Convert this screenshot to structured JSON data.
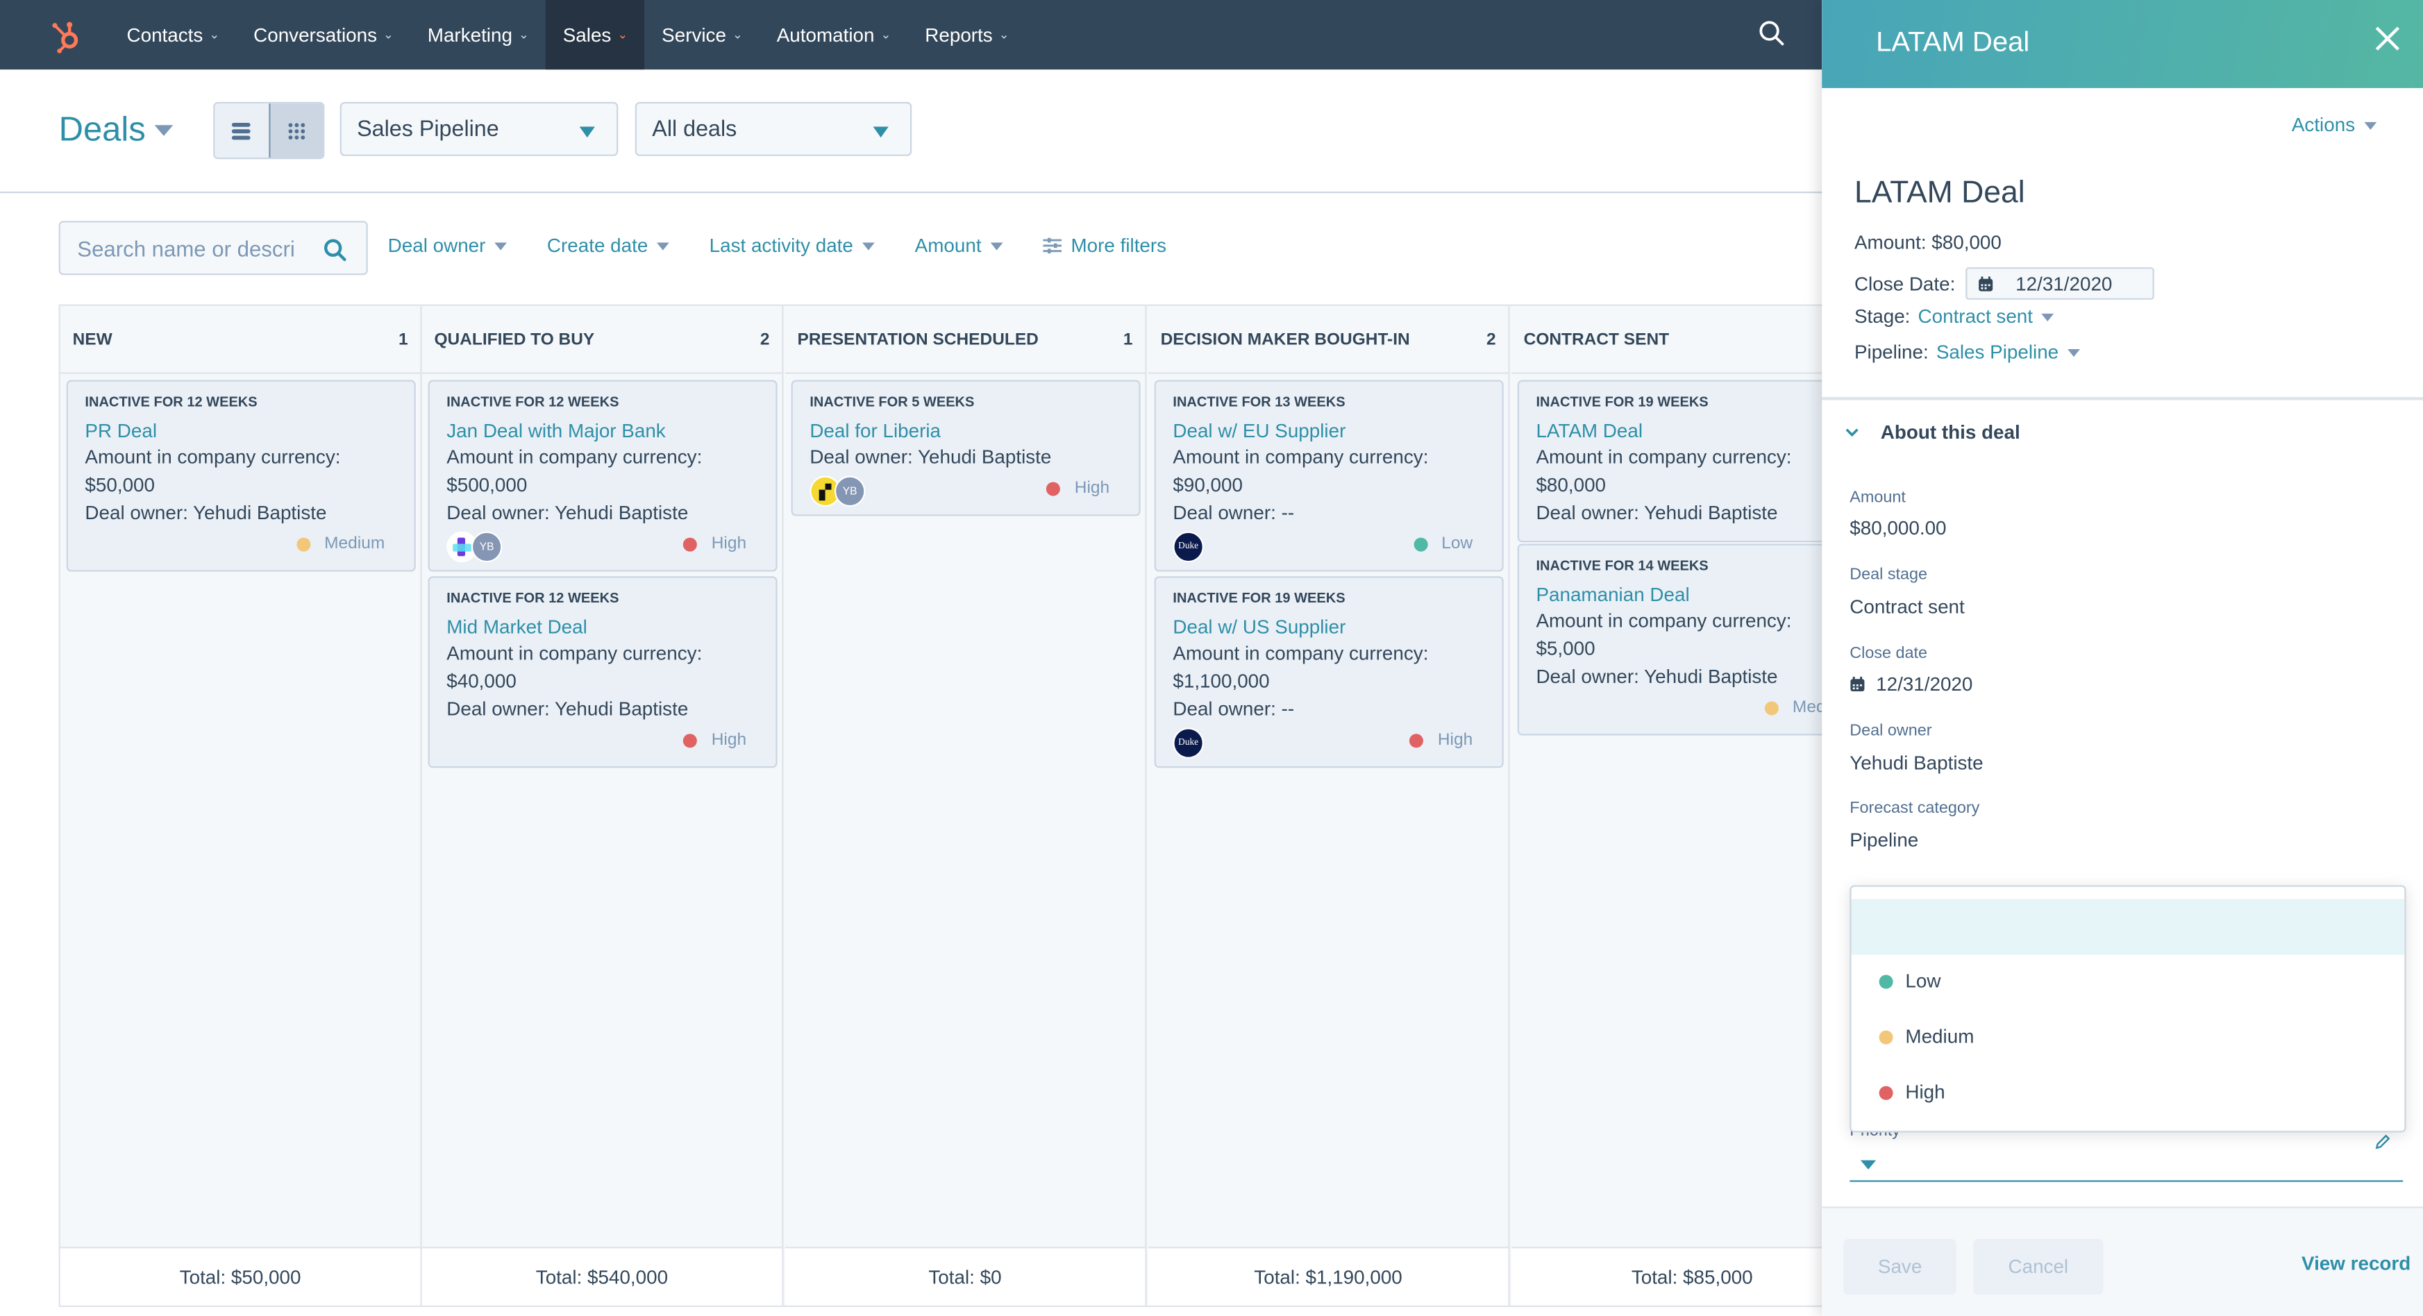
{
  "nav": {
    "items": [
      {
        "label": "Contacts",
        "active": false
      },
      {
        "label": "Conversations",
        "active": false
      },
      {
        "label": "Marketing",
        "active": false
      },
      {
        "label": "Sales",
        "active": true
      },
      {
        "label": "Service",
        "active": false
      },
      {
        "label": "Automation",
        "active": false
      },
      {
        "label": "Reports",
        "active": false
      }
    ],
    "chevron": "⌄",
    "logo_icon": "hubspot-sprocket",
    "search_icon": "search-icon"
  },
  "header": {
    "title": "Deals",
    "view_toggle": {
      "list_label": "list-view",
      "board_label": "board-view",
      "active": "board"
    },
    "pipeline_select": "Sales Pipeline",
    "view_select": "All deals"
  },
  "filters": {
    "search_placeholder": "Search name or descri",
    "items": [
      "Deal owner",
      "Create date",
      "Last activity date",
      "Amount"
    ],
    "more_filters": "More filters"
  },
  "board": {
    "columns": [
      {
        "title": "NEW",
        "count": "1",
        "total": "Total: $50,000"
      },
      {
        "title": "QUALIFIED TO BUY",
        "count": "2",
        "total": "Total: $540,000"
      },
      {
        "title": "PRESENTATION SCHEDULED",
        "count": "1",
        "total": "Total: $0"
      },
      {
        "title": "DECISION MAKER BOUGHT-IN",
        "count": "2",
        "total": "Total: $1,190,000"
      },
      {
        "title": "CONTRACT SENT",
        "count": "",
        "total": "Total: $85,000"
      }
    ],
    "cards": [
      {
        "inactive": "INACTIVE FOR 12 WEEKS",
        "name": "PR Deal",
        "amount_label": "Amount in company currency:",
        "amount": "$50,000",
        "owner_label": "Deal owner:",
        "owner": "Yehudi Baptiste",
        "priority": "Medium"
      },
      {
        "inactive": "INACTIVE FOR 12 WEEKS",
        "name": "Jan Deal with Major Bank",
        "amount_label": "Amount in company currency:",
        "amount": "$500,000",
        "owner_label": "Deal owner:",
        "owner": "Yehudi Baptiste",
        "priority": "High",
        "avatar_initials": "YB"
      },
      {
        "inactive": "INACTIVE FOR 12 WEEKS",
        "name": "Mid Market Deal",
        "amount_label": "Amount in company currency:",
        "amount": "$40,000",
        "owner_label": "Deal owner:",
        "owner": "Yehudi Baptiste",
        "priority": "High"
      },
      {
        "inactive": "INACTIVE FOR 5 WEEKS",
        "name": "Deal for Liberia",
        "owner_label": "Deal owner:",
        "owner": "Yehudi Baptiste",
        "priority": "High",
        "avatar_initials": "YB"
      },
      {
        "inactive": "INACTIVE FOR 13 WEEKS",
        "name": "Deal w/ EU Supplier",
        "amount_label": "Amount in company currency:",
        "amount": "$90,000",
        "owner_label": "Deal owner:",
        "owner": "--",
        "priority": "Low",
        "avatar_text": "Duke"
      },
      {
        "inactive": "INACTIVE FOR 19 WEEKS",
        "name": "Deal w/ US Supplier",
        "amount_label": "Amount in company currency:",
        "amount": "$1,100,000",
        "owner_label": "Deal owner:",
        "owner": "--",
        "priority": "High",
        "avatar_text": "Duke"
      },
      {
        "inactive": "INACTIVE FOR 19 WEEKS",
        "name": "LATAM Deal",
        "amount_label": "Amount in company currency:",
        "amount": "$80,000",
        "owner_label": "Deal owner:",
        "owner": "Yehudi Baptiste"
      },
      {
        "inactive": "INACTIVE FOR 14 WEEKS",
        "name": "Panamanian Deal",
        "amount_label": "Amount in company currency:",
        "amount": "$5,000",
        "owner_label": "Deal owner:",
        "owner": "Yehudi Baptiste",
        "priority": "Mediu"
      }
    ]
  },
  "priority_colors": {
    "Low": "#4fb9a5",
    "Medium": "#f2c77a",
    "High": "#e06263"
  },
  "panel": {
    "header_title": "LATAM Deal",
    "actions_label": "Actions",
    "deal_name": "LATAM Deal",
    "amount_line": "Amount: $80,000",
    "close_date_label": "Close Date:",
    "close_date": "12/31/2020",
    "stage_label": "Stage:",
    "stage": "Contract sent",
    "pipeline_label": "Pipeline:",
    "pipeline": "Sales Pipeline",
    "about_title": "About this deal",
    "props": [
      {
        "label": "Amount",
        "value": "$80,000.00"
      },
      {
        "label": "Deal stage",
        "value": "Contract sent"
      },
      {
        "label": "Close date",
        "value": "12/31/2020"
      },
      {
        "label": "Deal owner",
        "value": "Yehudi Baptiste"
      },
      {
        "label": "Forecast category",
        "value": "Pipeline"
      }
    ],
    "priority_label": "Priority",
    "priority_options": [
      "",
      "Low",
      "Medium",
      "High"
    ],
    "save_label": "Save",
    "cancel_label": "Cancel",
    "view_record_label": "View record"
  }
}
